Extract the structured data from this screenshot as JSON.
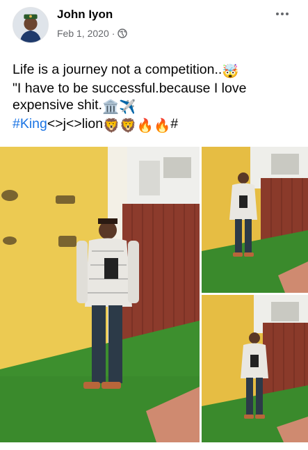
{
  "post": {
    "author": "John Iyon",
    "date": "Feb 1, 2020",
    "separator": "·",
    "privacy_icon": "globe-icon",
    "more_icon": "more-horizontal-icon",
    "text": {
      "line1": "Life is a journey not a competition..",
      "line1_emoji": "🤯",
      "line2": "\"I have to be successful.because I love",
      "line3": "expensive shit.",
      "line3_emoji": "🏛️✈️",
      "hashtag": "#King",
      "line4_rest": "<>j<>lion",
      "line4_emoji": "🦁🦁🔥🔥",
      "line4_end": "#"
    },
    "photos": [
      {
        "name": "main-photo"
      },
      {
        "name": "photo-top-right"
      },
      {
        "name": "photo-bottom-right"
      }
    ]
  },
  "colors": {
    "link": "#1b74e4",
    "secondary_text": "#65676b",
    "primary_text": "#050505",
    "wall_yellow": "#e8c24a",
    "fence_brown": "#8a3a2a",
    "grass_green": "#3a8a2c"
  }
}
